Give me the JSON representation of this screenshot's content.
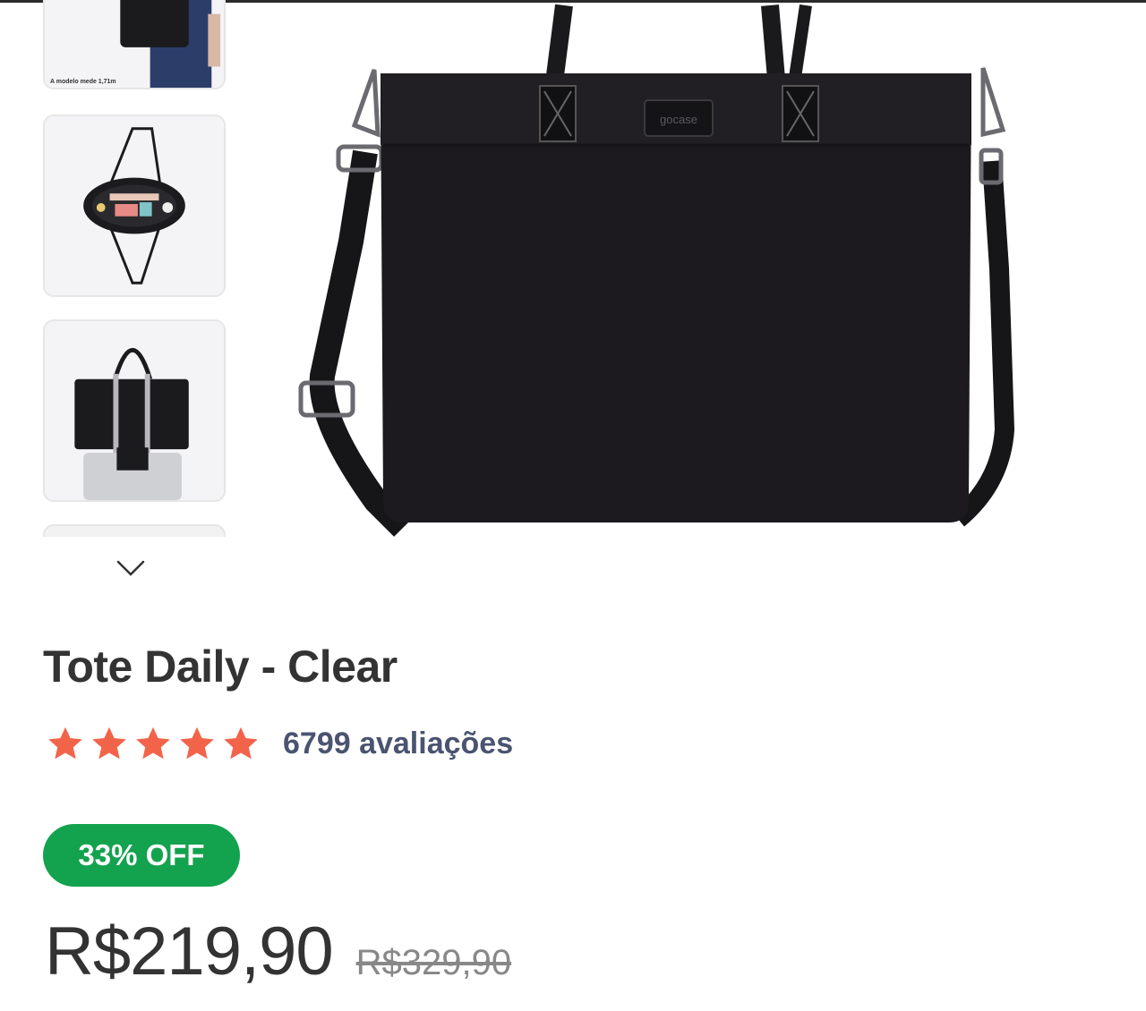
{
  "gallery": {
    "thumbnails": [
      {
        "alt": "model-wearing-tote",
        "caption": "A modelo mede 1,71m"
      },
      {
        "alt": "tote-interior-organized",
        "caption": ""
      },
      {
        "alt": "tote-on-luggage-handle",
        "caption": ""
      },
      {
        "alt": "tote-thumbnail-4",
        "caption": ""
      }
    ],
    "scroll_icon": "chevron-down-icon",
    "main_image_alt": "black-tote-bag-with-shoulder-strap",
    "brand_tag": "gocase"
  },
  "product": {
    "title": "Tote Daily - Clear",
    "rating": 5,
    "rating_max": 5,
    "star_color": "#f2644a",
    "review_count_label": "6799 avaliações",
    "discount_label": "33% OFF",
    "discount_color": "#13a24d",
    "price_current": "R$219,90",
    "price_old": "R$329,90"
  }
}
